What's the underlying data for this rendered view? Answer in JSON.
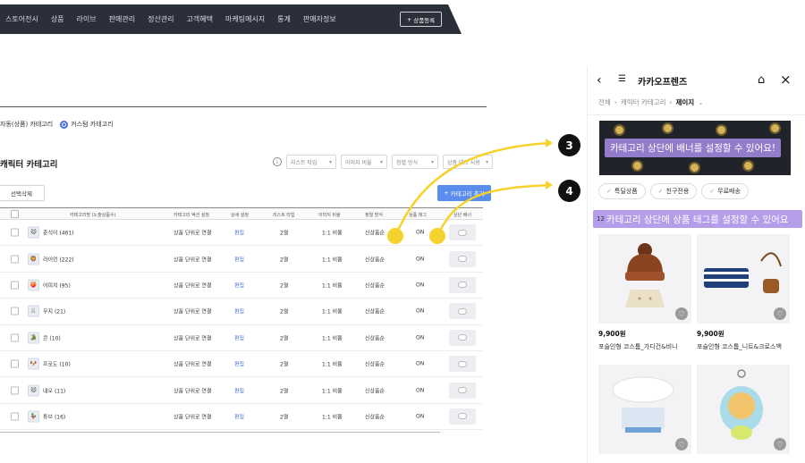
{
  "nav": {
    "items": [
      "스토어전시",
      "상품",
      "라이브",
      "판매관리",
      "정산관리",
      "고객혜택",
      "마케팅메시지",
      "통계",
      "판매자정보"
    ],
    "register_label": "상품등록",
    "register_icon": "plus-icon"
  },
  "category_type": {
    "auto_label": "자동(상품) 카테고리",
    "custom_label": "커스텀 카테고리",
    "selected": "custom"
  },
  "section": {
    "title": "캐릭터 카테고리",
    "filters": [
      "리스트 타입",
      "이미지 비율",
      "정렬 방식",
      "상품 태그 사용"
    ],
    "delete_label": "선택삭제",
    "add_label": "카테고리 추가"
  },
  "table": {
    "headers": [
      "카테고리명 (노출상품수)",
      "카테고리 액션 설정",
      "상세 설정",
      "리스트 타입",
      "이미지 비율",
      "정렬 방식",
      "상품 태그",
      "상단 배너"
    ],
    "rows": [
      {
        "name": "춘식이 (461)",
        "action": "상품 단위로 연결",
        "edit": "편집",
        "list": "2열",
        "ratio": "1:1 비율",
        "sort": "신상품순",
        "tag": "ON",
        "icon": "🐱"
      },
      {
        "name": "라이언 (222)",
        "action": "상품 단위로 연결",
        "edit": "편집",
        "list": "2열",
        "ratio": "1:1 비율",
        "sort": "신상품순",
        "tag": "ON",
        "icon": "🦁"
      },
      {
        "name": "어피치 (95)",
        "action": "상품 단위로 연결",
        "edit": "편집",
        "list": "2열",
        "ratio": "1:1 비율",
        "sort": "신상품순",
        "tag": "ON",
        "icon": "🍑"
      },
      {
        "name": "무지 (21)",
        "action": "상품 단위로 연결",
        "edit": "편집",
        "list": "2열",
        "ratio": "1:1 비율",
        "sort": "신상품순",
        "tag": "ON",
        "icon": "🐰"
      },
      {
        "name": "콘 (10)",
        "action": "상품 단위로 연결",
        "edit": "편집",
        "list": "2열",
        "ratio": "1:1 비율",
        "sort": "신상품순",
        "tag": "ON",
        "icon": "🐊"
      },
      {
        "name": "프로도 (10)",
        "action": "상품 단위로 연결",
        "edit": "편집",
        "list": "2열",
        "ratio": "1:1 비율",
        "sort": "신상품순",
        "tag": "ON",
        "icon": "🐶"
      },
      {
        "name": "네오 (11)",
        "action": "상품 단위로 연결",
        "edit": "편집",
        "list": "2열",
        "ratio": "1:1 비율",
        "sort": "신상품순",
        "tag": "ON",
        "icon": "🐱"
      },
      {
        "name": "튜브 (16)",
        "action": "상품 단위로 연결",
        "edit": "편집",
        "list": "2열",
        "ratio": "1:1 비율",
        "sort": "신상품순",
        "tag": "ON",
        "icon": "🦆"
      }
    ]
  },
  "callouts": {
    "banner_number": "3",
    "tag_number": "4"
  },
  "phone": {
    "title": "카카오프렌즈",
    "breadcrumbs": [
      "전체",
      "캐릭터 카테고리",
      "제이지"
    ],
    "banner_text": "카테고리 상단에 배너를 설정할 수 있어요!",
    "chips": [
      "특딜상품",
      "친구전용",
      "무료배송"
    ],
    "tag_text": "카테고리 상단에 상품 태그를 설정할 수 있어요",
    "tag_prefix": "12",
    "products": [
      {
        "price": "9,900원",
        "name": "포슬인형 코스튬_가디건&비니"
      },
      {
        "price": "9,900원",
        "name": "포슬인형 코스튬_니트&크로스백"
      },
      {
        "price": "",
        "name": ""
      },
      {
        "price": "",
        "name": ""
      }
    ]
  },
  "colors": {
    "nav_bg": "#2b2f3a",
    "accent": "#5b8def",
    "highlight": "#f6d22c",
    "tag_purple": "#a88ce6"
  }
}
